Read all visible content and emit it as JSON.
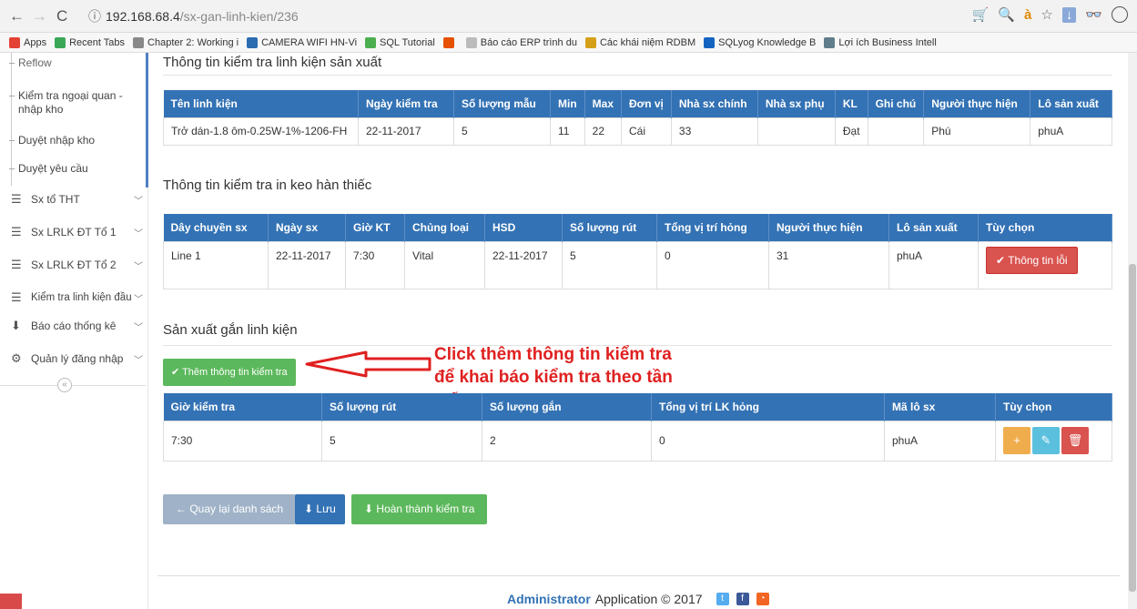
{
  "browser": {
    "url_host": "192.168.68.4",
    "url_path": "/sx-gan-linh-kien/236",
    "bookmarks": [
      {
        "label": "Apps",
        "color": "#e34133"
      },
      {
        "label": "Recent Tabs",
        "color": "#3aa757"
      },
      {
        "label": "Chapter 2: Working i",
        "color": "#888888"
      },
      {
        "label": "CAMERA WIFI HN-Vi",
        "color": "#2b6cb0"
      },
      {
        "label": "SQL Tutorial",
        "color": "#4caf50"
      },
      {
        "label": "",
        "color": "#e65100"
      },
      {
        "label": "Báo cáo ERP trình du",
        "color": "#bbbbbb"
      },
      {
        "label": "Các khái niệm RDBM",
        "color": "#d4a017"
      },
      {
        "label": "SQLyog Knowledge B",
        "color": "#1565c0"
      },
      {
        "label": "Lợi ích Business Intell",
        "color": "#607d8b"
      }
    ]
  },
  "sidebar": {
    "sub_items": [
      "Reflow",
      "Kiểm tra ngoại quan - nhập kho",
      "Duyệt nhập kho",
      "Duyệt yêu cầu"
    ],
    "menu": [
      {
        "label": "Sx tổ THT",
        "icon": "list-icon"
      },
      {
        "label": "Sx LRLK ĐT Tổ 1",
        "icon": "list-icon"
      },
      {
        "label": "Sx LRLK ĐT Tổ 2",
        "icon": "list-icon"
      },
      {
        "label": "Kiểm tra linh kiện đầu",
        "icon": "list-icon"
      },
      {
        "label": "Báo cáo thống kê",
        "icon": "download-icon"
      },
      {
        "label": "Quản lý đăng nhập",
        "icon": "gear-icon"
      }
    ]
  },
  "section1": {
    "title": "Thông tin kiểm tra linh kiện sản xuất",
    "headers": [
      "Tên linh kiện",
      "Ngày kiểm tra",
      "Số lượng mẫu",
      "Min",
      "Max",
      "Đơn vị",
      "Nhà sx chính",
      "Nhà sx phụ",
      "KL",
      "Ghi chú",
      "Người thực hiện",
      "Lô sản xuất"
    ],
    "row": [
      "Trở dán-1.8 ôm-0.25W-1%-1206-FH",
      "22-11-2017",
      "5",
      "11",
      "22",
      "Cái",
      "33",
      "",
      "Đạt",
      "",
      "Phú",
      "phuA"
    ]
  },
  "section2": {
    "title": "Thông tin kiểm tra in keo hàn thiếc",
    "headers": [
      "Dây chuyền sx",
      "Ngày sx",
      "Giờ KT",
      "Chủng loại",
      "HSD",
      "Số lượng rút",
      "Tổng vị trí hỏng",
      "Người thực hiện",
      "Lô sản xuất",
      "Tùy chọn"
    ],
    "row": [
      "Line 1",
      "22-11-2017",
      "7:30",
      "Vital",
      "22-11-2017",
      "5",
      "0",
      "31",
      "phuA"
    ],
    "error_button": "Thông tin lỗi"
  },
  "section3": {
    "title": "Sản xuất gắn linh kiện",
    "add_button": "Thêm thông tin kiểm tra",
    "annotation_line1": "Click thêm thông tin kiểm tra",
    "annotation_line2": "để khai báo kiểm tra theo tần",
    "annotation_line3": "suất",
    "headers": [
      "Giờ kiểm tra",
      "Số lượng rút",
      "Số lượng gắn",
      "Tổng vị trí LK hỏng",
      "Mã lô sx",
      "Tùy chọn"
    ],
    "row": [
      "7:30",
      "5",
      "2",
      "0",
      "phuA"
    ]
  },
  "actions": {
    "back": "Quay lại danh sách",
    "save": "Lưu",
    "complete": "Hoàn thành kiểm tra"
  },
  "footer": {
    "admin": "Administrator",
    "text": "Application © 2017"
  },
  "colors": {
    "header_blue": "#3372b4",
    "danger": "#d9534f",
    "success": "#5cb85c",
    "warning": "#f0ad4e",
    "info": "#5bc0de",
    "muted": "#9fb2c7"
  }
}
